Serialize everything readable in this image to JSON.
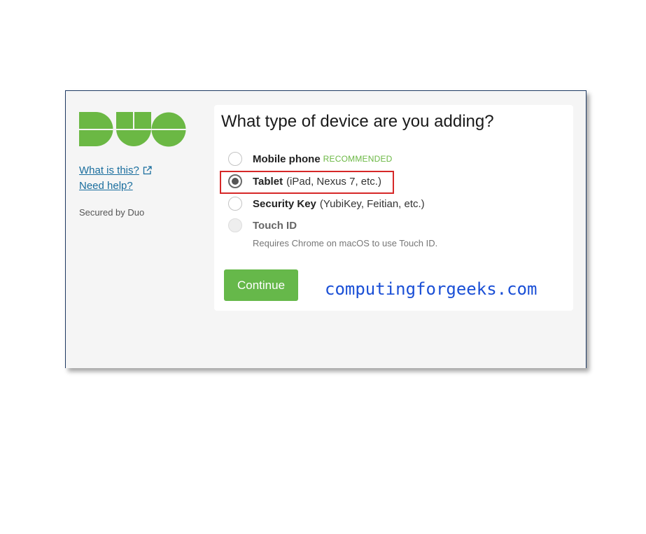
{
  "sidebar": {
    "logo_text": "DUO",
    "brand_color": "#6bb844",
    "links": [
      {
        "label": "What is this?",
        "icon": "external-link-icon"
      },
      {
        "label": "Need help?"
      }
    ],
    "secured_by": "Secured by Duo"
  },
  "card": {
    "title": "What type of device are you adding?",
    "options": [
      {
        "label": "Mobile phone",
        "detail": "",
        "badge": "RECOMMENDED",
        "selected": false,
        "disabled": false
      },
      {
        "label": "Tablet",
        "detail": "(iPad, Nexus 7, etc.)",
        "badge": "",
        "selected": true,
        "disabled": false
      },
      {
        "label": "Security Key",
        "detail": "(YubiKey, Feitian, etc.)",
        "badge": "",
        "selected": false,
        "disabled": false
      },
      {
        "label": "Touch ID",
        "detail": "",
        "badge": "",
        "selected": false,
        "disabled": true
      }
    ],
    "touch_id_hint": "Requires Chrome on macOS to use Touch ID.",
    "continue_label": "Continue",
    "button_color": "#66b84a",
    "highlight_color": "#d62828"
  },
  "watermark": "computingforgeeks.com"
}
